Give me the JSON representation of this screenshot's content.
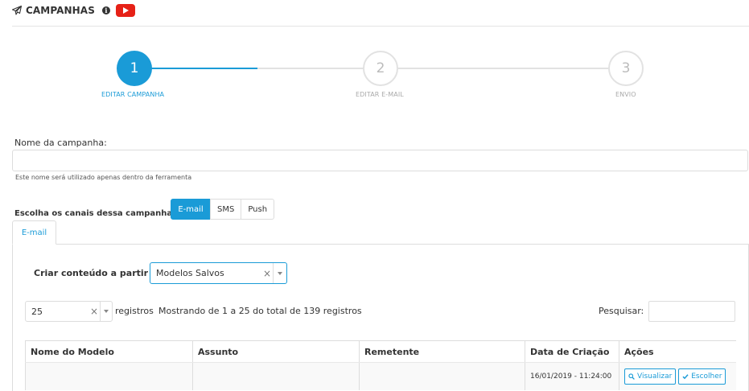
{
  "header": {
    "title": "CAMPANHAS",
    "icons": [
      "paper-plane-icon",
      "info-icon",
      "youtube-icon"
    ]
  },
  "stepper": {
    "steps": [
      {
        "number": "1",
        "label": "EDITAR CAMPANHA",
        "active": true
      },
      {
        "number": "2",
        "label": "EDITAR E-MAIL",
        "active": false
      },
      {
        "number": "3",
        "label": "ENVIO",
        "active": false
      }
    ]
  },
  "form": {
    "name_label": "Nome da campanha:",
    "name_value": "",
    "name_help": "Este nome será utilizado apenas dentro da ferramenta",
    "channels_label": "Escolha os canais dessa campanha:",
    "channels": [
      "E-mail",
      "SMS",
      "Push"
    ],
    "selected_channel": "E-mail"
  },
  "tabs": [
    "E-mail"
  ],
  "content": {
    "criar_label": "Criar conteúdo a partir de:",
    "criar_value": "Modelos Salvos"
  },
  "table_controls": {
    "page_length": "25",
    "registros_label": "registros",
    "info": "Mostrando de 1 a 25 do total de 139 registros",
    "search_label": "Pesquisar:",
    "search_value": ""
  },
  "table": {
    "columns": [
      "Nome do Modelo",
      "Assunto",
      "Remetente",
      "Data de Criação",
      "Ações"
    ],
    "rows": [
      {
        "nome": "",
        "assunto": "",
        "remetente": "",
        "data": "16/01/2019 - 11:24:00"
      }
    ],
    "actions": {
      "view": "Visualizar",
      "choose": "Escolher"
    }
  },
  "colors": {
    "accent": "#1a9bd7",
    "youtube": "#e62117"
  }
}
